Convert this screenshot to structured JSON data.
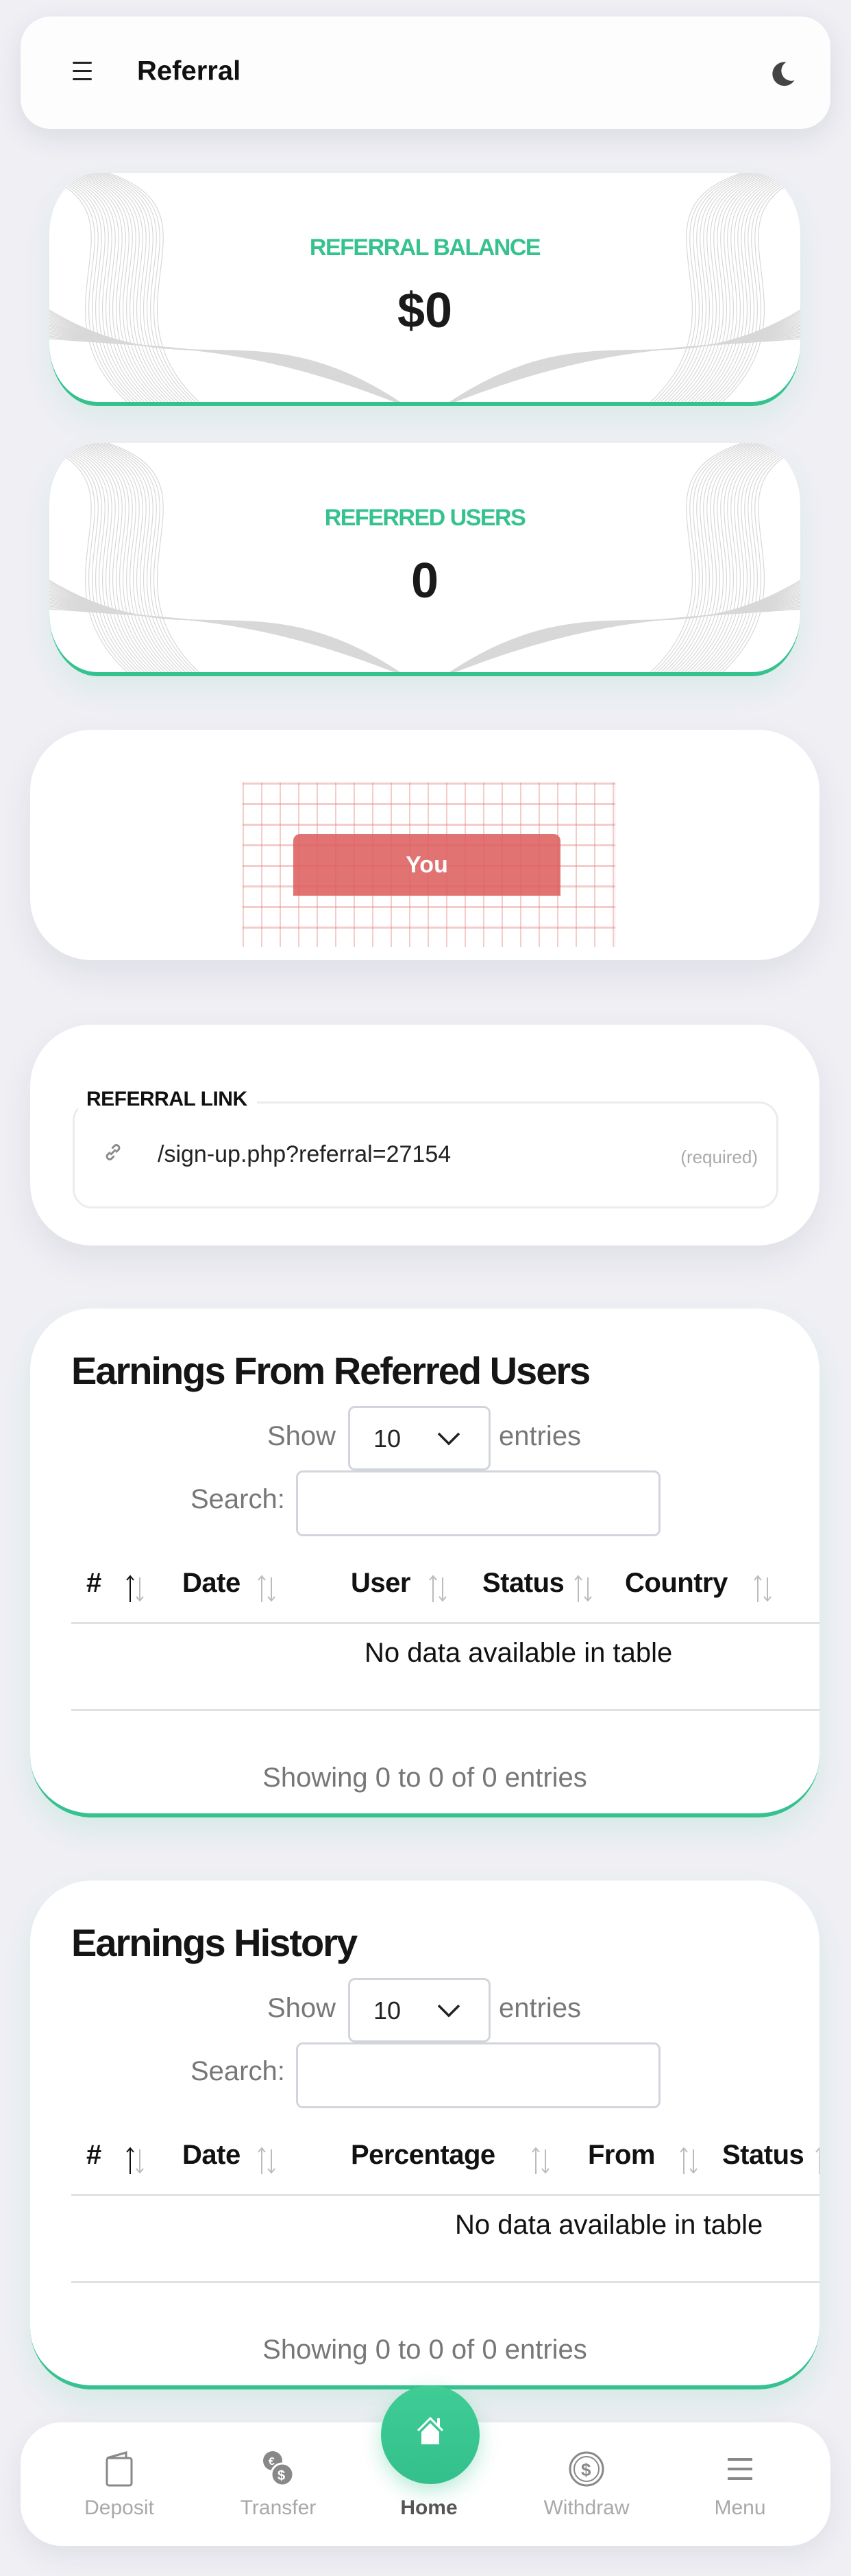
{
  "header": {
    "title": "Referral",
    "menu_icon": "hamburger-icon",
    "theme_icon": "moon-icon"
  },
  "stats": [
    {
      "label": "REFERRAL BALANCE",
      "value": "$0"
    },
    {
      "label": "REFERRED USERS",
      "value": "0"
    }
  ],
  "tree": {
    "you_label": "You"
  },
  "referral_link": {
    "legend": "REFERRAL LINK",
    "icon": "link-icon",
    "value": "/sign-up.php?referral=27154",
    "hint": "(required)"
  },
  "tables": [
    {
      "title": "Earnings From Referred Users",
      "show_label": "Show",
      "page_size": "10",
      "entries_label": "entries",
      "search_label": "Search:",
      "search_value": "",
      "columns": [
        "#",
        "Date",
        "User",
        "Status",
        "Country"
      ],
      "empty_text": "No data available in table",
      "info": "Showing 0 to 0 of 0 entries"
    },
    {
      "title": "Earnings History",
      "show_label": "Show",
      "page_size": "10",
      "entries_label": "entries",
      "search_label": "Search:",
      "search_value": "",
      "columns": [
        "#",
        "Date",
        "Percentage",
        "From",
        "Status"
      ],
      "empty_text": "No data available in table",
      "info": "Showing 0 to 0 of 0 entries"
    }
  ],
  "bottom_nav": {
    "items": [
      {
        "label": "Deposit",
        "icon": "wallet-icon"
      },
      {
        "label": "Transfer",
        "icon": "currency-exchange-icon"
      },
      {
        "label": "Home",
        "icon": "home-icon",
        "active": true
      },
      {
        "label": "Withdraw",
        "icon": "dollar-coin-icon"
      },
      {
        "label": "Menu",
        "icon": "menu-icon"
      }
    ]
  },
  "colors": {
    "accent": "#35c28f",
    "you_node": "#e06e6e",
    "background": "#efeff4"
  }
}
